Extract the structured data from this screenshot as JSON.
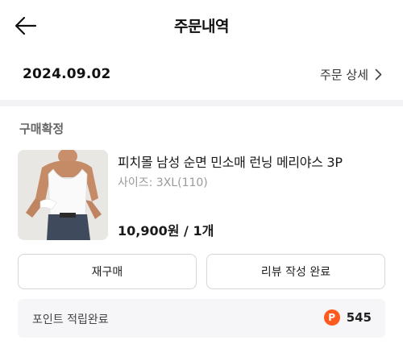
{
  "header": {
    "title": "주문내역",
    "back_icon": "arrow-left-icon"
  },
  "order": {
    "date": "2024.09.02",
    "detail_label": "주문 상세",
    "detail_icon": "chevron-right-icon"
  },
  "item": {
    "status": "구매확정",
    "name": "피치몰 남성 순면 민소매 런닝 메리야스 3P",
    "option": "사이즈: 3XL(110)",
    "price_qty": "10,900원 / 1개",
    "thumbnail_icon": "product-image"
  },
  "actions": {
    "rebuy_label": "재구매",
    "review_label": "리뷰 작성 완료"
  },
  "points": {
    "label": "포인트 적립완료",
    "badge": "P",
    "badge_color": "#ff5a1f",
    "value": "545"
  }
}
